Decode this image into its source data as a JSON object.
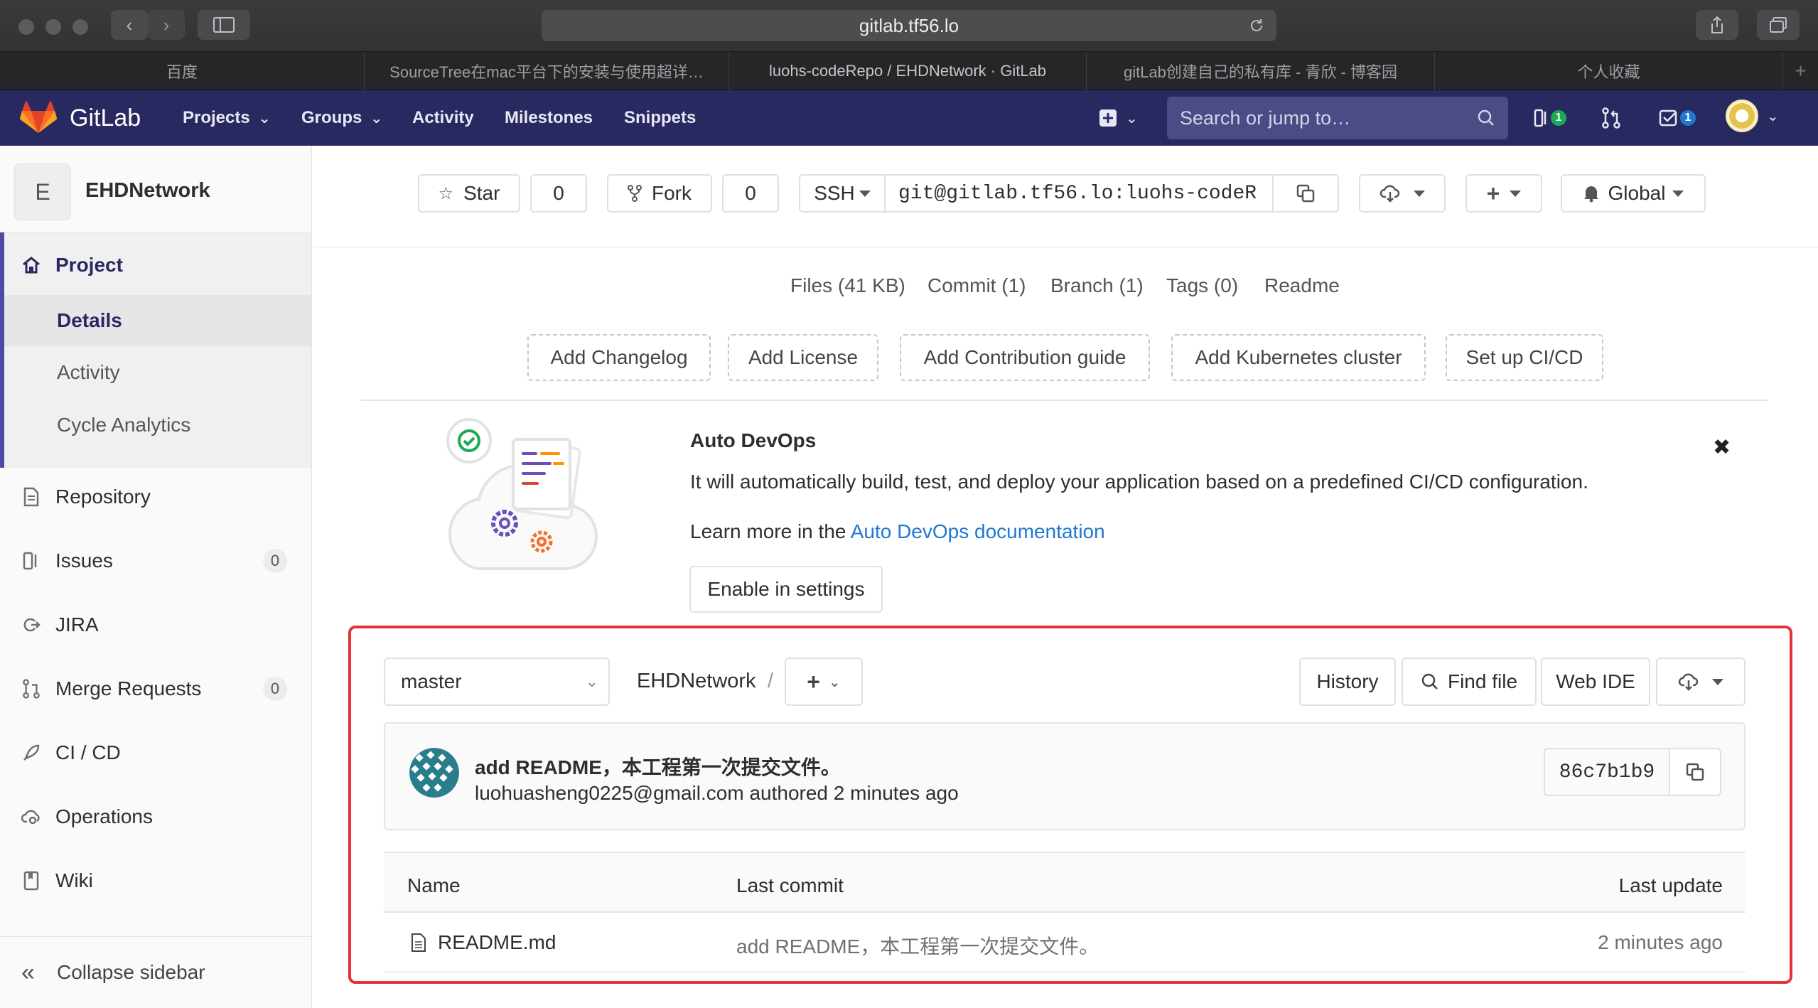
{
  "browser": {
    "url": "gitlab.tf56.lo",
    "tabs": [
      {
        "label": "百度"
      },
      {
        "label": "SourceTree在mac平台下的安装与使用超详…"
      },
      {
        "label": "luohs-codeRepo / EHDNetwork · GitLab"
      },
      {
        "label": "gitLab创建自己的私有库 - 青欣 - 博客园"
      },
      {
        "label": "个人收藏"
      }
    ]
  },
  "navbar": {
    "brand": "GitLab",
    "links": [
      {
        "label": "Projects"
      },
      {
        "label": "Groups"
      },
      {
        "label": "Activity"
      },
      {
        "label": "Milestones"
      },
      {
        "label": "Snippets"
      }
    ],
    "search_placeholder": "Search or jump to…",
    "issues_count": "1",
    "todos_count": "1"
  },
  "sidebar": {
    "project_initial": "E",
    "project_name": "EHDNetwork",
    "section": "Project",
    "subitems": [
      {
        "label": "Details"
      },
      {
        "label": "Activity"
      },
      {
        "label": "Cycle Analytics"
      }
    ],
    "items": [
      {
        "label": "Repository"
      },
      {
        "label": "Issues",
        "count": "0"
      },
      {
        "label": "JIRA"
      },
      {
        "label": "Merge Requests",
        "count": "0"
      },
      {
        "label": "CI / CD"
      },
      {
        "label": "Operations"
      },
      {
        "label": "Wiki"
      }
    ],
    "collapse_label": "Collapse sidebar"
  },
  "project_header": {
    "star_label": "Star",
    "star_count": "0",
    "fork_label": "Fork",
    "fork_count": "0",
    "clone_protocol": "SSH",
    "clone_url": "git@gitlab.tf56.lo:luohs-codeR",
    "notification_label": "Global"
  },
  "stats": [
    {
      "label": "Files (41 KB)"
    },
    {
      "label": "Commit (1)"
    },
    {
      "label": "Branch (1)"
    },
    {
      "label": "Tags (0)"
    },
    {
      "label": "Readme"
    }
  ],
  "quick_actions": [
    {
      "label": "Add Changelog"
    },
    {
      "label": "Add License"
    },
    {
      "label": "Add Contribution guide"
    },
    {
      "label": "Add Kubernetes cluster"
    },
    {
      "label": "Set up CI/CD"
    }
  ],
  "autodevops": {
    "title": "Auto DevOps",
    "description": "It will automatically build, test, and deploy your application based on a predefined CI/CD configuration.",
    "learn_prefix": "Learn more in the ",
    "learn_link": "Auto DevOps documentation",
    "button": "Enable in settings"
  },
  "repo": {
    "branch": "master",
    "path_root": "EHDNetwork",
    "path_sep": "/",
    "history_label": "History",
    "find_file_label": "Find file",
    "web_ide_label": "Web IDE"
  },
  "last_commit": {
    "message": "add README，本工程第一次提交文件。",
    "author": "luohuasheng0225@gmail.com",
    "meta": "authored 2 minutes ago",
    "sha": "86c7b1b9"
  },
  "file_table": {
    "headers": {
      "name": "Name",
      "last_commit": "Last commit",
      "last_update": "Last update"
    },
    "rows": [
      {
        "name": "README.md",
        "last_commit": "add README，本工程第一次提交文件。",
        "last_update": "2 minutes ago"
      }
    ]
  },
  "colors": {
    "navbar": "#292961",
    "highlight_border": "#e5313a",
    "link": "#1f78d1",
    "sidebar_active": "#4b4ba3"
  }
}
